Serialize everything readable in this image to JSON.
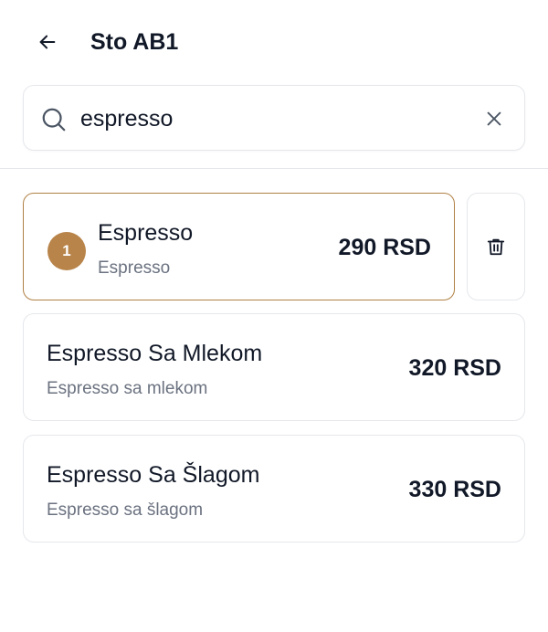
{
  "header": {
    "title": "Sto AB1"
  },
  "search": {
    "value": "espresso",
    "placeholder": ""
  },
  "items": [
    {
      "name": "Espresso",
      "description": "Espresso",
      "price": "290 RSD",
      "quantity": "1",
      "selected": true
    },
    {
      "name": "Espresso Sa Mlekom",
      "description": "Espresso sa mlekom",
      "price": "320 RSD",
      "selected": false
    },
    {
      "name": "Espresso Sa Šlagom",
      "description": "Espresso sa šlagom",
      "price": "330 RSD",
      "selected": false
    }
  ],
  "icons": {
    "back": "arrow-left-icon",
    "search": "search-icon",
    "clear": "close-icon",
    "delete": "trash-icon"
  },
  "colors": {
    "accent": "#b8844a",
    "selected_border": "#b08045",
    "text_primary": "#111827",
    "text_secondary": "#6b7280",
    "border": "#e5e7eb"
  }
}
